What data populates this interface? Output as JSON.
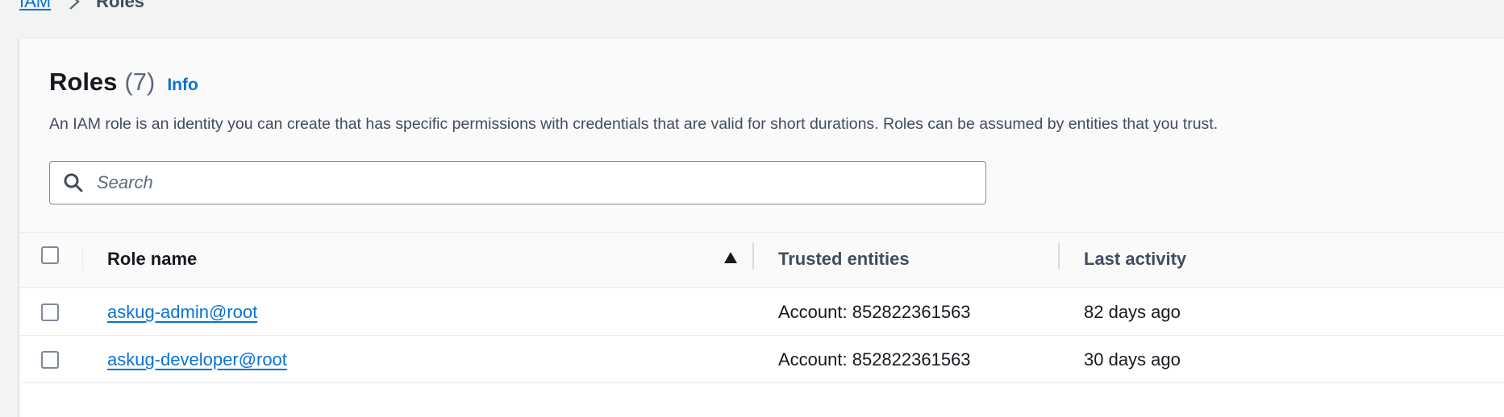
{
  "breadcrumb": {
    "parent": "IAM",
    "current": "Roles"
  },
  "header": {
    "title": "Roles",
    "count": "(7)",
    "info": "Info",
    "description": "An IAM role is an identity you can create that has specific permissions with credentials that are valid for short durations. Roles can be assumed by entities that you trust."
  },
  "search": {
    "placeholder": "Search",
    "value": ""
  },
  "table": {
    "columns": [
      "Role name",
      "Trusted entities",
      "Last activity"
    ],
    "sort": {
      "column": "Role name",
      "direction": "ascending"
    },
    "rows": [
      {
        "role_name": "askug-admin@root",
        "trusted_entities": "Account: 852822361563",
        "last_activity": "82 days ago",
        "selected": false
      },
      {
        "role_name": "askug-developer@root",
        "trusted_entities": "Account: 852822361563",
        "last_activity": "30 days ago",
        "selected": false
      }
    ]
  },
  "colors": {
    "link": "#0972d3",
    "text": "#16191f",
    "secondary_text": "#414d5c",
    "background": "#f2f3f3"
  },
  "icons": {
    "search": "search-icon",
    "breadcrumb_separator": "chevron-right-icon",
    "sort": "sort-ascending-icon"
  }
}
